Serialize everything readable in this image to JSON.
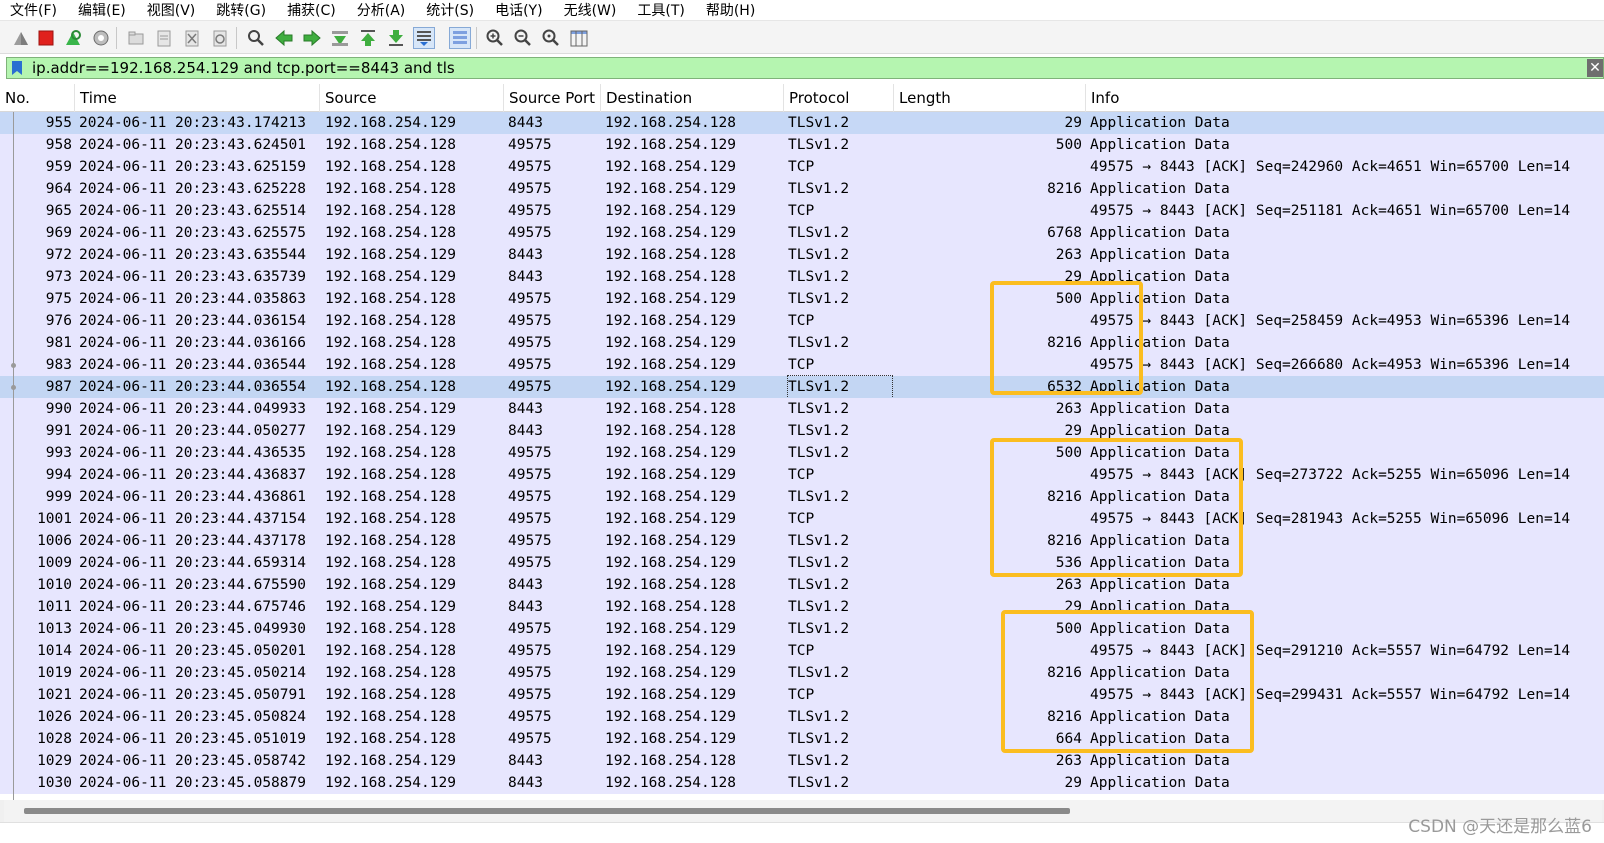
{
  "menu": [
    {
      "label": "文件(F)"
    },
    {
      "label": "编辑(E)"
    },
    {
      "label": "视图(V)"
    },
    {
      "label": "跳转(G)"
    },
    {
      "label": "捕获(C)"
    },
    {
      "label": "分析(A)"
    },
    {
      "label": "统计(S)"
    },
    {
      "label": "电话(Y)"
    },
    {
      "label": "无线(W)"
    },
    {
      "label": "工具(T)"
    },
    {
      "label": "帮助(H)"
    }
  ],
  "toolbar": {
    "icons": [
      "shark-fin-start-icon",
      "stop-capture-icon",
      "restart-capture-icon",
      "capture-options-icon",
      "open-file-icon",
      "save-file-icon",
      "close-file-icon",
      "reload-file-icon",
      "find-packet-icon",
      "go-back-icon",
      "go-forward-icon",
      "go-to-packet-icon",
      "go-first-icon",
      "go-last-icon",
      "autoscroll-icon",
      "colorize-icon",
      "zoom-in-icon",
      "zoom-out-icon",
      "zoom-reset-icon",
      "resize-columns-icon"
    ],
    "colors": {
      "stop": "#e0211d",
      "restart": "#39b54a",
      "arrows": "#3fae3f"
    }
  },
  "filter": {
    "value": "ip.addr==192.168.254.129 and tcp.port==8443 and tls",
    "clear_label": "✕",
    "background_color": "#b5f5b0"
  },
  "columns": {
    "no": "No.",
    "time": "Time",
    "source": "Source",
    "source_port": "Source Port",
    "destination": "Destination",
    "protocol": "Protocol",
    "length": "Length",
    "info": "Info"
  },
  "packets": [
    {
      "no": "955",
      "time": "2024-06-11 20:23:43.174213",
      "src": "192.168.254.129",
      "sport": "8443",
      "dst": "192.168.254.128",
      "proto": "TLSv1.2",
      "len": "29",
      "info": "Application Data"
    },
    {
      "no": "958",
      "time": "2024-06-11 20:23:43.624501",
      "src": "192.168.254.128",
      "sport": "49575",
      "dst": "192.168.254.129",
      "proto": "TLSv1.2",
      "len": "500",
      "info": "Application Data"
    },
    {
      "no": "959",
      "time": "2024-06-11 20:23:43.625159",
      "src": "192.168.254.128",
      "sport": "49575",
      "dst": "192.168.254.129",
      "proto": "TCP",
      "len": "",
      "info": "49575 → 8443 [ACK] Seq=242960 Ack=4651 Win=65700 Len=14"
    },
    {
      "no": "964",
      "time": "2024-06-11 20:23:43.625228",
      "src": "192.168.254.128",
      "sport": "49575",
      "dst": "192.168.254.129",
      "proto": "TLSv1.2",
      "len": "8216",
      "info": "Application Data"
    },
    {
      "no": "965",
      "time": "2024-06-11 20:23:43.625514",
      "src": "192.168.254.128",
      "sport": "49575",
      "dst": "192.168.254.129",
      "proto": "TCP",
      "len": "",
      "info": "49575 → 8443 [ACK] Seq=251181 Ack=4651 Win=65700 Len=14"
    },
    {
      "no": "969",
      "time": "2024-06-11 20:23:43.625575",
      "src": "192.168.254.128",
      "sport": "49575",
      "dst": "192.168.254.129",
      "proto": "TLSv1.2",
      "len": "6768",
      "info": "Application Data"
    },
    {
      "no": "972",
      "time": "2024-06-11 20:23:43.635544",
      "src": "192.168.254.129",
      "sport": "8443",
      "dst": "192.168.254.128",
      "proto": "TLSv1.2",
      "len": "263",
      "info": "Application Data"
    },
    {
      "no": "973",
      "time": "2024-06-11 20:23:43.635739",
      "src": "192.168.254.129",
      "sport": "8443",
      "dst": "192.168.254.128",
      "proto": "TLSv1.2",
      "len": "29",
      "info": "Application Data"
    },
    {
      "no": "975",
      "time": "2024-06-11 20:23:44.035863",
      "src": "192.168.254.128",
      "sport": "49575",
      "dst": "192.168.254.129",
      "proto": "TLSv1.2",
      "len": "500",
      "info": "Application Data"
    },
    {
      "no": "976",
      "time": "2024-06-11 20:23:44.036154",
      "src": "192.168.254.128",
      "sport": "49575",
      "dst": "192.168.254.129",
      "proto": "TCP",
      "len": "",
      "info": "49575 → 8443 [ACK] Seq=258459 Ack=4953 Win=65396 Len=14"
    },
    {
      "no": "981",
      "time": "2024-06-11 20:23:44.036166",
      "src": "192.168.254.128",
      "sport": "49575",
      "dst": "192.168.254.129",
      "proto": "TLSv1.2",
      "len": "8216",
      "info": "Application Data"
    },
    {
      "no": "983",
      "time": "2024-06-11 20:23:44.036544",
      "src": "192.168.254.128",
      "sport": "49575",
      "dst": "192.168.254.129",
      "proto": "TCP",
      "len": "",
      "info": "49575 → 8443 [ACK] Seq=266680 Ack=4953 Win=65396 Len=14"
    },
    {
      "no": "987",
      "time": "2024-06-11 20:23:44.036554",
      "src": "192.168.254.128",
      "sport": "49575",
      "dst": "192.168.254.129",
      "proto": "TLSv1.2",
      "len": "6532",
      "info": "Application Data",
      "selected": true
    },
    {
      "no": "990",
      "time": "2024-06-11 20:23:44.049933",
      "src": "192.168.254.129",
      "sport": "8443",
      "dst": "192.168.254.128",
      "proto": "TLSv1.2",
      "len": "263",
      "info": "Application Data"
    },
    {
      "no": "991",
      "time": "2024-06-11 20:23:44.050277",
      "src": "192.168.254.129",
      "sport": "8443",
      "dst": "192.168.254.128",
      "proto": "TLSv1.2",
      "len": "29",
      "info": "Application Data"
    },
    {
      "no": "993",
      "time": "2024-06-11 20:23:44.436535",
      "src": "192.168.254.128",
      "sport": "49575",
      "dst": "192.168.254.129",
      "proto": "TLSv1.2",
      "len": "500",
      "info": "Application Data"
    },
    {
      "no": "994",
      "time": "2024-06-11 20:23:44.436837",
      "src": "192.168.254.128",
      "sport": "49575",
      "dst": "192.168.254.129",
      "proto": "TCP",
      "len": "",
      "info": "49575 → 8443 [ACK] Seq=273722 Ack=5255 Win=65096 Len=14"
    },
    {
      "no": "999",
      "time": "2024-06-11 20:23:44.436861",
      "src": "192.168.254.128",
      "sport": "49575",
      "dst": "192.168.254.129",
      "proto": "TLSv1.2",
      "len": "8216",
      "info": "Application Data"
    },
    {
      "no": "1001",
      "time": "2024-06-11 20:23:44.437154",
      "src": "192.168.254.128",
      "sport": "49575",
      "dst": "192.168.254.129",
      "proto": "TCP",
      "len": "",
      "info": "49575 → 8443 [ACK] Seq=281943 Ack=5255 Win=65096 Len=14"
    },
    {
      "no": "1006",
      "time": "2024-06-11 20:23:44.437178",
      "src": "192.168.254.128",
      "sport": "49575",
      "dst": "192.168.254.129",
      "proto": "TLSv1.2",
      "len": "8216",
      "info": "Application Data"
    },
    {
      "no": "1009",
      "time": "2024-06-11 20:23:44.659314",
      "src": "192.168.254.128",
      "sport": "49575",
      "dst": "192.168.254.129",
      "proto": "TLSv1.2",
      "len": "536",
      "info": "Application Data"
    },
    {
      "no": "1010",
      "time": "2024-06-11 20:23:44.675590",
      "src": "192.168.254.129",
      "sport": "8443",
      "dst": "192.168.254.128",
      "proto": "TLSv1.2",
      "len": "263",
      "info": "Application Data"
    },
    {
      "no": "1011",
      "time": "2024-06-11 20:23:44.675746",
      "src": "192.168.254.129",
      "sport": "8443",
      "dst": "192.168.254.128",
      "proto": "TLSv1.2",
      "len": "29",
      "info": "Application Data"
    },
    {
      "no": "1013",
      "time": "2024-06-11 20:23:45.049930",
      "src": "192.168.254.128",
      "sport": "49575",
      "dst": "192.168.254.129",
      "proto": "TLSv1.2",
      "len": "500",
      "info": "Application Data"
    },
    {
      "no": "1014",
      "time": "2024-06-11 20:23:45.050201",
      "src": "192.168.254.128",
      "sport": "49575",
      "dst": "192.168.254.129",
      "proto": "TCP",
      "len": "",
      "info": "49575 → 8443 [ACK] Seq=291210 Ack=5557 Win=64792 Len=14"
    },
    {
      "no": "1019",
      "time": "2024-06-11 20:23:45.050214",
      "src": "192.168.254.128",
      "sport": "49575",
      "dst": "192.168.254.129",
      "proto": "TLSv1.2",
      "len": "8216",
      "info": "Application Data"
    },
    {
      "no": "1021",
      "time": "2024-06-11 20:23:45.050791",
      "src": "192.168.254.128",
      "sport": "49575",
      "dst": "192.168.254.129",
      "proto": "TCP",
      "len": "",
      "info": "49575 → 8443 [ACK] Seq=299431 Ack=5557 Win=64792 Len=14"
    },
    {
      "no": "1026",
      "time": "2024-06-11 20:23:45.050824",
      "src": "192.168.254.128",
      "sport": "49575",
      "dst": "192.168.254.129",
      "proto": "TLSv1.2",
      "len": "8216",
      "info": "Application Data"
    },
    {
      "no": "1028",
      "time": "2024-06-11 20:23:45.051019",
      "src": "192.168.254.128",
      "sport": "49575",
      "dst": "192.168.254.129",
      "proto": "TLSv1.2",
      "len": "664",
      "info": "Application Data"
    },
    {
      "no": "1029",
      "time": "2024-06-11 20:23:45.058742",
      "src": "192.168.254.129",
      "sport": "8443",
      "dst": "192.168.254.128",
      "proto": "TLSv1.2",
      "len": "263",
      "info": "Application Data"
    },
    {
      "no": "1030",
      "time": "2024-06-11 20:23:45.058879",
      "src": "192.168.254.129",
      "sport": "8443",
      "dst": "192.168.254.128",
      "proto": "TLSv1.2",
      "len": "29",
      "info": "Application Data"
    }
  ],
  "row_colors": {
    "tls": "#e7e6fe",
    "selected": "#c3d6f3"
  },
  "highlight_color": "#fbbd20",
  "watermark": "CSDN @天还是那么蓝6"
}
